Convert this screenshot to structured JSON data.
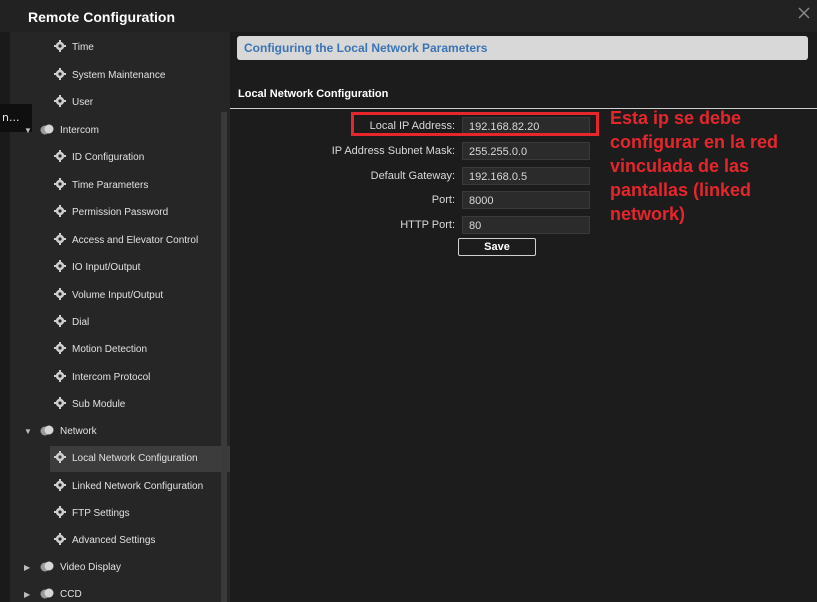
{
  "window": {
    "title": "Remote Configuration",
    "close_icon": "close-icon"
  },
  "sidebar": {
    "ghost_text": "n...",
    "items": [
      {
        "label": "Time",
        "icon": "gear-icon",
        "level": 2
      },
      {
        "label": "System Maintenance",
        "icon": "gear-icon",
        "level": 2
      },
      {
        "label": "User",
        "icon": "gear-icon",
        "level": 2
      },
      {
        "label": "Intercom",
        "icon": "folder-icon",
        "level": 1,
        "expanded": true
      },
      {
        "label": "ID Configuration",
        "icon": "gear-icon",
        "level": 2
      },
      {
        "label": "Time Parameters",
        "icon": "gear-icon",
        "level": 2
      },
      {
        "label": "Permission Password",
        "icon": "gear-icon",
        "level": 2
      },
      {
        "label": "Access and Elevator Control",
        "icon": "gear-icon",
        "level": 2
      },
      {
        "label": "IO Input/Output",
        "icon": "gear-icon",
        "level": 2
      },
      {
        "label": "Volume Input/Output",
        "icon": "gear-icon",
        "level": 2
      },
      {
        "label": "Dial",
        "icon": "gear-icon",
        "level": 2
      },
      {
        "label": "Motion Detection",
        "icon": "gear-icon",
        "level": 2
      },
      {
        "label": "Intercom Protocol",
        "icon": "gear-icon",
        "level": 2
      },
      {
        "label": "Sub Module",
        "icon": "gear-icon",
        "level": 2
      },
      {
        "label": "Network",
        "icon": "folder-icon",
        "level": 1,
        "expanded": true
      },
      {
        "label": "Local Network Configuration",
        "icon": "gear-icon",
        "level": 2,
        "selected": true
      },
      {
        "label": "Linked Network Configuration",
        "icon": "gear-icon",
        "level": 2
      },
      {
        "label": "FTP Settings",
        "icon": "gear-icon",
        "level": 2
      },
      {
        "label": "Advanced Settings",
        "icon": "gear-icon",
        "level": 2
      },
      {
        "label": "Video Display",
        "icon": "folder-icon",
        "level": 1,
        "expanded": false
      },
      {
        "label": "CCD",
        "icon": "folder-icon",
        "level": 1,
        "expanded": false
      }
    ]
  },
  "main": {
    "header": "Configuring the Local Network Parameters",
    "section_title": "Local Network Configuration",
    "fields": [
      {
        "label": "Local IP Address:",
        "value": "192.168.82.20"
      },
      {
        "label": "IP Address Subnet Mask:",
        "value": "255.255.0.0"
      },
      {
        "label": "Default Gateway:",
        "value": "192.168.0.5"
      },
      {
        "label": "Port:",
        "value": "8000"
      },
      {
        "label": "HTTP Port:",
        "value": "80"
      }
    ],
    "save_label": "Save"
  },
  "annotation": {
    "text": "Esta ip se debe configurar en la red vinculada de las pantallas (linked network)",
    "color": "#e5262c"
  },
  "colors": {
    "header_text": "#3c74b4",
    "panel_bg": "#1c1c1c",
    "sidebar_bg": "#262626"
  }
}
